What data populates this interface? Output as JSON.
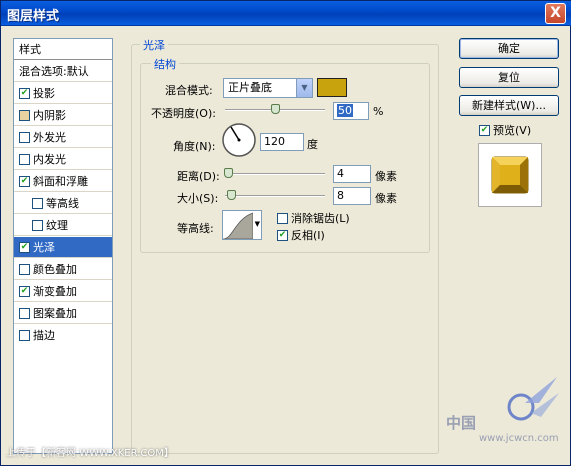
{
  "window": {
    "title": "图层样式",
    "close_label": "X"
  },
  "style_list": {
    "header": "样式",
    "blend_options": "混合选项:默认",
    "items": [
      {
        "label": "投影",
        "checked": true
      },
      {
        "label": "内阴影",
        "checked": false
      },
      {
        "label": "外发光",
        "checked": false
      },
      {
        "label": "内发光",
        "checked": false
      },
      {
        "label": "斜面和浮雕",
        "checked": true
      },
      {
        "label": "等高线",
        "checked": false
      },
      {
        "label": "纹理",
        "checked": false
      },
      {
        "label": "光泽",
        "checked": true
      },
      {
        "label": "颜色叠加",
        "checked": false
      },
      {
        "label": "渐变叠加",
        "checked": true
      },
      {
        "label": "图案叠加",
        "checked": false
      },
      {
        "label": "描边",
        "checked": false
      }
    ]
  },
  "panel": {
    "title": "光泽",
    "structure": "结构",
    "blend_mode_label": "混合模式:",
    "blend_mode_value": "正片叠底",
    "swatch_color": "#c9a30e",
    "opacity_label": "不透明度(O):",
    "opacity_value": "50",
    "opacity_unit": "%",
    "angle_label": "角度(N):",
    "angle_value": "120",
    "angle_unit": "度",
    "distance_label": "距离(D):",
    "distance_value": "4",
    "distance_unit": "像素",
    "size_label": "大小(S):",
    "size_value": "8",
    "size_unit": "像素",
    "contour_label": "等高线:",
    "antialias_label": "消除锯齿(L)",
    "antialias_checked": false,
    "invert_label": "反相(I)",
    "invert_checked": true
  },
  "buttons": {
    "ok": "确定",
    "reset": "复位",
    "new_style": "新建样式(W)...",
    "preview_label": "预览(V)",
    "preview_checked": true
  },
  "watermarks": {
    "bottom": "上传于【新客网 WWW.XKER.COM】",
    "site": "www.jcwcn.com",
    "brand": "中国"
  }
}
